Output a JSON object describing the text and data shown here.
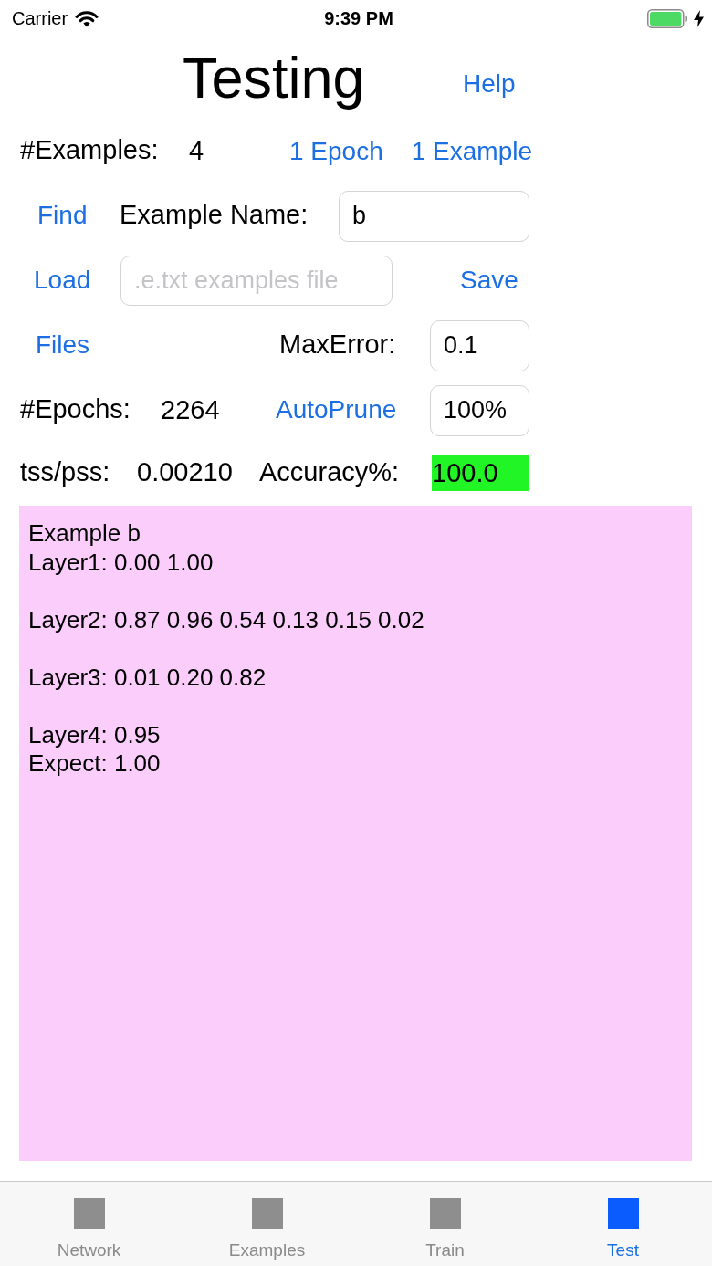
{
  "status_bar": {
    "carrier": "Carrier",
    "time": "9:39 PM"
  },
  "header": {
    "title": "Testing",
    "help_button": "Help"
  },
  "examples_row": {
    "label": "#Examples:",
    "value": "4",
    "buttons": [
      "1 Epoch",
      "1 Example"
    ]
  },
  "find_row": {
    "button": "Find",
    "label": "Example Name:",
    "field": {
      "value": "b"
    }
  },
  "load_row": {
    "button": "Load",
    "field": {
      "placeholder": ".e.txt examples file"
    },
    "save_button": "Save"
  },
  "files_row": {
    "button": "Files",
    "label": "MaxError:",
    "field": {
      "value": "0.1"
    }
  },
  "epochs_row": {
    "label": "#Epochs:",
    "value": "2264",
    "button": "AutoPrune",
    "field": {
      "value": "100%"
    }
  },
  "stats_row": {
    "label": "tss/pss:",
    "value": "0.00210",
    "accuracy_label": "Accuracy%:",
    "accuracy": {
      "value": "100.0",
      "highlighted": true
    }
  },
  "output": {
    "paragraphs": [
      [
        "Example b",
        "Layer1: 0.00 1.00"
      ],
      [
        "Layer2: 0.87 0.96 0.54 0.13 0.15 0.02"
      ],
      [
        "Layer3: 0.01 0.20 0.82"
      ],
      [
        "Layer4: 0.95",
        "Expect: 1.00"
      ]
    ]
  },
  "tab_bar": {
    "tabs": [
      {
        "label": "Network",
        "selected": false
      },
      {
        "label": "Examples",
        "selected": false
      },
      {
        "label": "Train",
        "selected": false
      },
      {
        "label": "Test",
        "selected": true
      }
    ]
  }
}
